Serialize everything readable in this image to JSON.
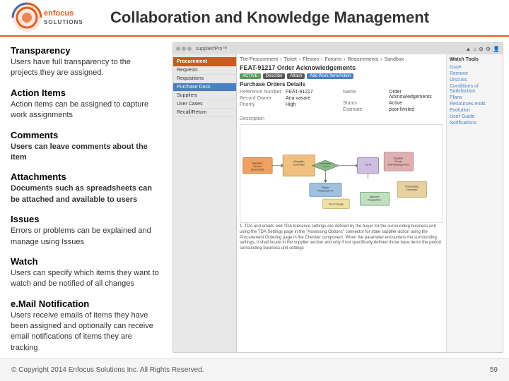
{
  "header": {
    "title": "Collaboration and Knowledge Management",
    "logo_enfocus": "enfocus",
    "logo_solutions": "SOLUTIONS"
  },
  "features": [
    {
      "id": "transparency",
      "title": "Transparency",
      "desc": "Users have full transparency to the projects they are assigned."
    },
    {
      "id": "action_items",
      "title": "Action Items",
      "desc": "Action items can be assigned to capture work assignments"
    },
    {
      "id": "comments",
      "title": "Comments",
      "desc_bold": "Users can leave comments about the item",
      "desc": ""
    },
    {
      "id": "attachments",
      "title": "Attachments",
      "desc_bold": "Documents such as spreadsheets can be attached and available to users",
      "desc": ""
    },
    {
      "id": "issues",
      "title": "Issues",
      "desc": "Errors or problems can be explained and manage using Issues"
    },
    {
      "id": "watch",
      "title": "Watch",
      "desc": "Users can specify which items they want to watch and be notified of all changes"
    },
    {
      "id": "email",
      "title": "e.Mail Notification",
      "desc": "Users receive emails of items they have been assigned and optionally can receive email notifications of items they are tracking"
    }
  ],
  "mockup": {
    "toolbar_text": "supplierfPro™",
    "nav_header": "Procurement",
    "nav_items": [
      "Requests",
      "Requisitions",
      "Purchase Docs",
      "Suppliers",
      "User Cases",
      "Recall/Return"
    ],
    "breadcrumb": [
      "The Procurement",
      "Ticket",
      "Flexors",
      "Forums",
      "Requirements",
      "Sandbox"
    ],
    "active_item": "Purchase Docs",
    "page_title": "FEAT-91217 Order Acknowledgements",
    "status_badge": "ACTIVE",
    "buttons": [
      "Describe",
      "Attach",
      "Add Work Item/Action"
    ],
    "feature_title": "Purchase Orders Details",
    "form_fields": [
      {
        "label": "Reference Number",
        "value": "FEAT-91217"
      },
      {
        "label": "Record Owner",
        "value": "Ana vasare"
      },
      {
        "label": "Priority",
        "value": "High"
      }
    ],
    "form_fields_right": [
      {
        "label": "Name",
        "value": "Order Acknowledgements"
      },
      {
        "label": "Status",
        "value": "Active"
      },
      {
        "label": "Estimate",
        "value": "poor limited"
      }
    ],
    "right_sidebar": {
      "title": "Watch Tools",
      "items": [
        "Issue",
        "Remove",
        "Discuss",
        "Conditions of Satisfaction",
        "Plans",
        "Resources ends",
        "Evolution",
        "User Guide",
        "Notifications"
      ]
    }
  },
  "footer": {
    "copyright": "© Copyright 2014 Enfocus Solutions Inc. All Rights Reserved.",
    "page_number": "59"
  }
}
